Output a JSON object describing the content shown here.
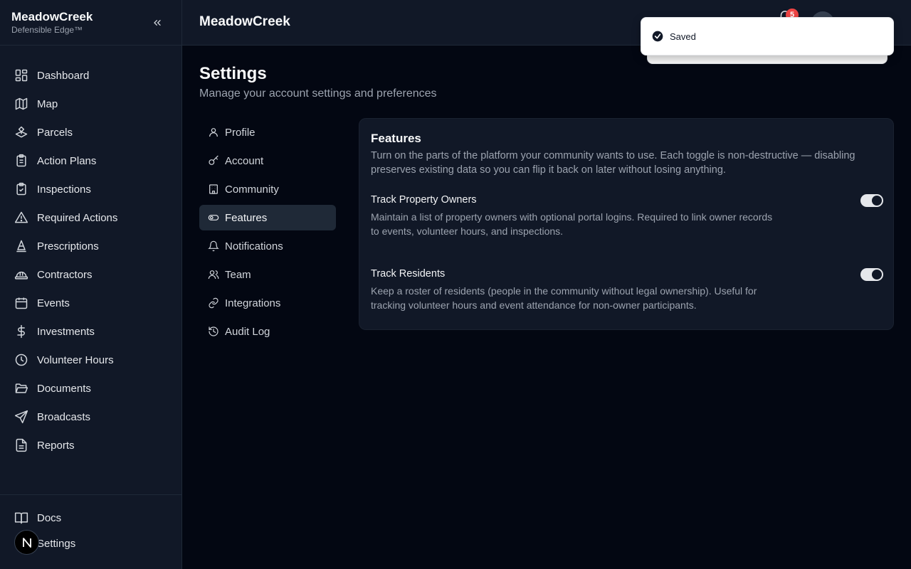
{
  "app": {
    "brand_name": "MeadowCreek",
    "brand_sub": "Defensible Edge™"
  },
  "sidebar": {
    "items": [
      {
        "label": "Dashboard",
        "icon": "dashboard-icon"
      },
      {
        "label": "Map",
        "icon": "map-icon"
      },
      {
        "label": "Parcels",
        "icon": "parcels-icon"
      },
      {
        "label": "Action Plans",
        "icon": "clipboard-list-icon"
      },
      {
        "label": "Inspections",
        "icon": "clipboard-check-icon"
      },
      {
        "label": "Required Actions",
        "icon": "warning-triangle-icon"
      },
      {
        "label": "Prescriptions",
        "icon": "cone-icon"
      },
      {
        "label": "Contractors",
        "icon": "hard-hat-icon"
      },
      {
        "label": "Events",
        "icon": "calendar-icon"
      },
      {
        "label": "Investments",
        "icon": "dollar-icon"
      },
      {
        "label": "Volunteer Hours",
        "icon": "clock-icon"
      },
      {
        "label": "Documents",
        "icon": "folder-open-icon"
      },
      {
        "label": "Broadcasts",
        "icon": "send-icon"
      },
      {
        "label": "Reports",
        "icon": "file-text-icon"
      }
    ],
    "bottom": [
      {
        "label": "Docs",
        "icon": "book-icon"
      },
      {
        "label": "Settings",
        "icon": "gear-icon"
      }
    ],
    "avatar_letter": "N"
  },
  "header": {
    "title": "MeadowCreek",
    "notification_count": "5"
  },
  "toast": {
    "message": "Saved"
  },
  "page": {
    "title": "Settings",
    "subtitle": "Manage your account settings and preferences"
  },
  "settings_nav": [
    {
      "label": "Profile",
      "icon": "user-icon",
      "active": false
    },
    {
      "label": "Account",
      "icon": "key-icon",
      "active": false
    },
    {
      "label": "Community",
      "icon": "building-icon",
      "active": false
    },
    {
      "label": "Features",
      "icon": "toggle-icon",
      "active": true
    },
    {
      "label": "Notifications",
      "icon": "bell-icon",
      "active": false
    },
    {
      "label": "Team",
      "icon": "users-icon",
      "active": false
    },
    {
      "label": "Integrations",
      "icon": "link-icon",
      "active": false
    },
    {
      "label": "Audit Log",
      "icon": "history-icon",
      "active": false
    }
  ],
  "features": {
    "title": "Features",
    "description": "Turn on the parts of the platform your community wants to use. Each toggle is non-destructive — disabling preserves existing data so you can flip it back on later without losing anything.",
    "items": [
      {
        "title": "Track Property Owners",
        "description": "Maintain a list of property owners with optional portal logins. Required to link owner records to events, volunteer hours, and inspections.",
        "enabled": true
      },
      {
        "title": "Track Residents",
        "description": "Keep a roster of residents (people in the community without legal ownership). Useful for tracking volunteer hours and event attendance for non-owner participants.",
        "enabled": true
      }
    ]
  },
  "colors": {
    "background": "#030712",
    "panel": "#111827",
    "active_nav": "#1f2937",
    "badge": "#ef4444",
    "toast_bg": "#ffffff"
  }
}
